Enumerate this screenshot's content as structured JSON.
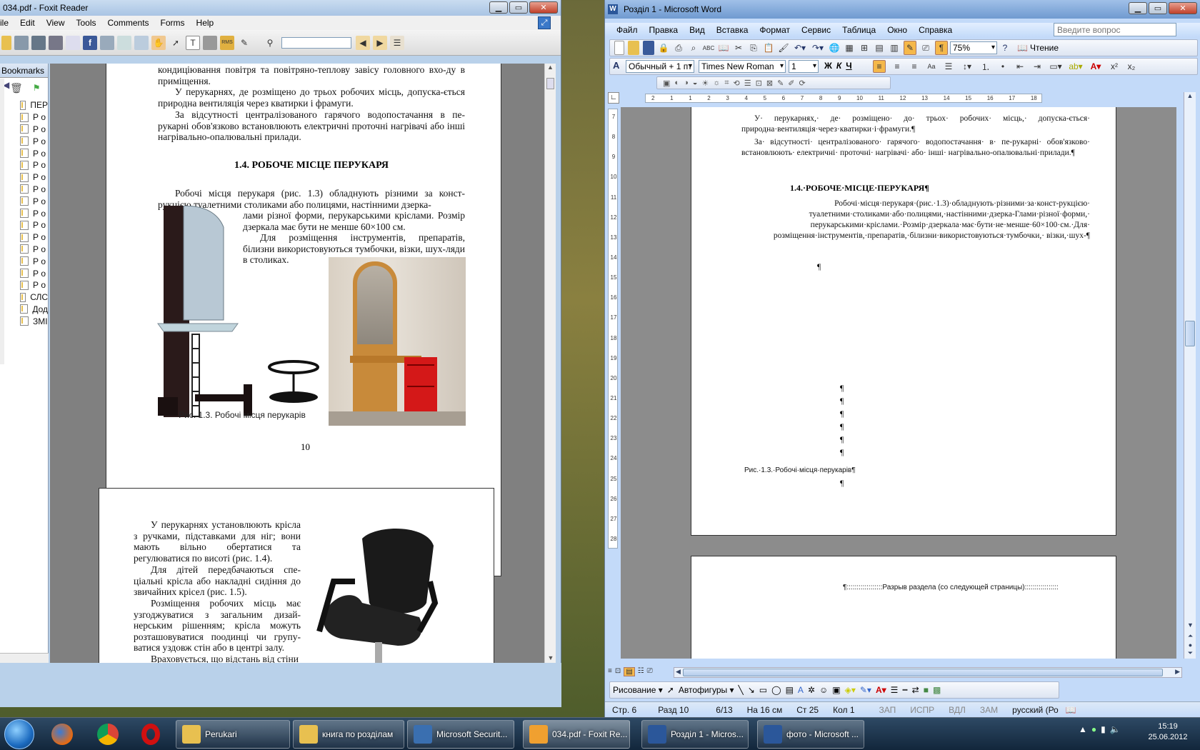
{
  "foxit": {
    "title": "034.pdf - Foxit Reader",
    "menu": [
      "ile",
      "Edit",
      "View",
      "Tools",
      "Comments",
      "Forms",
      "Help"
    ],
    "bookmarks_label": "Bookmarks",
    "bookmarks": [
      "ПЕР",
      "Р о",
      "Р о",
      "Р о",
      "Р о",
      "Р о",
      "Р о",
      "Р о",
      "Р о",
      "Р о",
      "Р о",
      "Р о",
      "Р о",
      "Р о",
      "Р о",
      "Р о",
      "СЛС",
      "Дод",
      "ЗМІ"
    ],
    "page1": {
      "top_text": "кондиціювання повітря та повітряно-теплову завісу головного вхо-ду в приміщення.",
      "p1": "У перукарнях, де розміщено до трьох робочих місць, допуска-ється природна вентиляція через кватирки і фрамуги.",
      "p2": "За відсутності централізованого гарячого водопостачання в пе-рукарні обов'язково встановлюють електричні проточні нагрівачі або інші нагрівально-опалювальні прилади.",
      "heading": "1.4. РОБОЧЕ МІСЦЕ ПЕРУКАРЯ",
      "p3a": "Робочі місця перукаря (рис. 1.3) обладнують різними за конст-рукцією туалетними столиками або полицями, настінними дзерка-",
      "p3b": "лами різної форми, перукарськими кріслами. Розмір дзеркала має бути не менше 60×100 см.",
      "p4": "Для розміщення інструментів, препаратів, білизни використовуються тумбочки, візки, шух-ляди в столиках.",
      "caption": "Рис. 1.3. Робочі місця перукарів",
      "page_number": "10"
    },
    "page2": {
      "p1": "У перукарнях установлюють крісла з ручками, підставками для ніг; вони мають вільно обертатися та регулюватися по висоті (рис. 1.4).",
      "p2": "Для дітей передбачаються спе-ціальні крісла або накладні сидіння до звичайних крісел (рис. 1.5).",
      "p3": "Розміщення робочих місць має узгоджуватися з загальним дизай-нерським рішенням; крісла можуть розташовуватися поодинці чи групу-ватися уздовж стін або в центрі залу.",
      "p4": "Враховується, що відстань від стіни"
    }
  },
  "word": {
    "title": "Розділ 1 - Microsoft Word",
    "menu": [
      "Файл",
      "Правка",
      "Вид",
      "Вставка",
      "Формат",
      "Сервис",
      "Таблица",
      "Окно",
      "Справка"
    ],
    "help_placeholder": "Введите вопрос",
    "zoom": "75%",
    "reading": "Чтение",
    "style": "Обычный + 1 пт",
    "font": "Times New Roman",
    "size": "1",
    "ruler_h": [
      "2",
      "1",
      "1",
      "2",
      "3",
      "4",
      "5",
      "6",
      "7",
      "8",
      "9",
      "10",
      "11",
      "12",
      "13",
      "14",
      "15",
      "16",
      "17",
      "18"
    ],
    "ruler_v": [
      "7",
      "8",
      "9",
      "10",
      "11",
      "12",
      "13",
      "14",
      "15",
      "16",
      "17",
      "18",
      "19",
      "20",
      "21",
      "22",
      "23",
      "24",
      "25",
      "26",
      "27",
      "28"
    ],
    "doc": {
      "p1": "У· перукарнях,· де· розміщено· до· трьох· робочих· місць,· допуска-ється· природна·вентиляція·через·кватирки·і·фрамуги.¶",
      "p2": "За· відсутності· централізованого· гарячого· водопостачання· в· пе-рукарні· обов'язково· встановлюють· електричні· проточні· нагрівачі· або· інші· нагрівально-опалювальні·прилади.¶",
      "heading": "1.4.·РОБОЧЕ·МІСЦЕ·ПЕРУКАРЯ¶",
      "p3": "Робочі·місця·перукаря·(рис.·1.3)·обладнують·різними·за·конст-рукцією· туалетними·столиками·або·полицями,·настінними·дзерка-Глами·різної·форми,· перукарськими·кріслами.·Розмір·дзеркала·має·бути·не·менше·60×100·см.·Для· розміщення·інструментів,·препаратів,·білизни·використовуються·тумбочки,· візки,·шух-¶",
      "pilcrow": "¶",
      "caption": "Рис.·1.3.·Робочі·місця·перукарів¶",
      "section_break": "¶::::::::::::::::::Разрыв раздела (со следующей страницы):::::::::::::::::"
    },
    "drawing_label": "Рисование",
    "autoshapes_label": "Автофигуры",
    "status": {
      "page": "Стр. 6",
      "section": "Разд 10",
      "pages": "6/13",
      "at": "На 16 см",
      "line": "Ст 25",
      "col": "Кол 1",
      "rec": "ЗАП",
      "trk": "ИСПР",
      "ext": "ВДЛ",
      "ovr": "ЗАМ",
      "lang": "русский (Ро"
    }
  },
  "taskbar": {
    "items": [
      "Perukari",
      "книга по розділам",
      "Microsoft Securit...",
      "034.pdf - Foxit Re...",
      "Розділ 1 - Micros...",
      "фото - Microsoft ..."
    ],
    "time": "15:19",
    "date": "25.06.2012"
  },
  "colors": {
    "word_blue": "#c3daf9",
    "foxit_frame": "#b9d1ea",
    "taskbar": "#1c3a5a"
  }
}
